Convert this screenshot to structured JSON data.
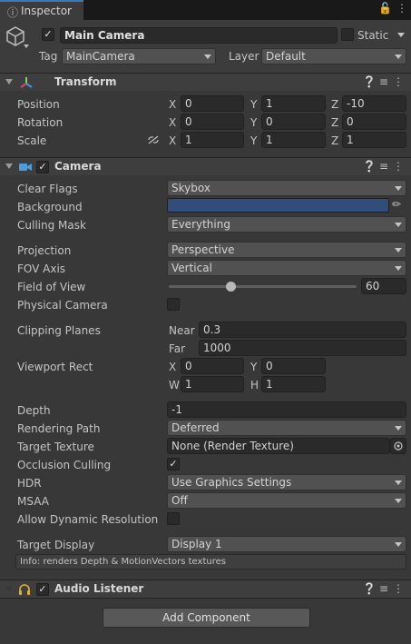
{
  "tab": {
    "label": "Inspector",
    "icon": "info-icon",
    "lock_icon": "lock-icon",
    "menu_icon": "kebab-menu-icon"
  },
  "gameobject": {
    "name": "Main Camera",
    "static_label": "Static",
    "tag_label": "Tag",
    "tag_value": "MainCamera",
    "layer_label": "Layer",
    "layer_value": "Default"
  },
  "transform": {
    "title": "Transform",
    "position_label": "Position",
    "rotation_label": "Rotation",
    "scale_label": "Scale",
    "axis_x": "X",
    "axis_y": "Y",
    "axis_z": "Z",
    "position": {
      "x": "0",
      "y": "1",
      "z": "-10"
    },
    "rotation": {
      "x": "0",
      "y": "0",
      "z": "0"
    },
    "scale": {
      "x": "1",
      "y": "1",
      "z": "1"
    }
  },
  "camera": {
    "title": "Camera",
    "clear_flags_label": "Clear Flags",
    "clear_flags_value": "Skybox",
    "background_label": "Background",
    "background_color": "#314d79",
    "culling_mask_label": "Culling Mask",
    "culling_mask_value": "Everything",
    "projection_label": "Projection",
    "projection_value": "Perspective",
    "fov_axis_label": "FOV Axis",
    "fov_axis_value": "Vertical",
    "fov_label": "Field of View",
    "fov_value": "60",
    "fov_slider_fraction": 0.33,
    "physical_camera_label": "Physical Camera",
    "clipping_label": "Clipping Planes",
    "near_label": "Near",
    "near_value": "0.3",
    "far_label": "Far",
    "far_value": "1000",
    "viewport_label": "Viewport Rect",
    "vp_x_label": "X",
    "vp_x": "0",
    "vp_y_label": "Y",
    "vp_y": "0",
    "vp_w_label": "W",
    "vp_w": "1",
    "vp_h_label": "H",
    "vp_h": "1",
    "depth_label": "Depth",
    "depth_value": "-1",
    "rendering_path_label": "Rendering Path",
    "rendering_path_value": "Deferred",
    "target_texture_label": "Target Texture",
    "target_texture_value": "None (Render Texture)",
    "occlusion_label": "Occlusion Culling",
    "hdr_label": "HDR",
    "hdr_value": "Use Graphics Settings",
    "msaa_label": "MSAA",
    "msaa_value": "Off",
    "dynres_label": "Allow Dynamic Resolution",
    "target_display_label": "Target Display",
    "target_display_value": "Display 1",
    "info_text": "Info: renders Depth & MotionVectors textures"
  },
  "audio_listener": {
    "title": "Audio Listener"
  },
  "add_component_label": "Add Component",
  "colors": {
    "accent": "#3a79bb",
    "panel": "#383838",
    "header": "#3e3e3e"
  }
}
